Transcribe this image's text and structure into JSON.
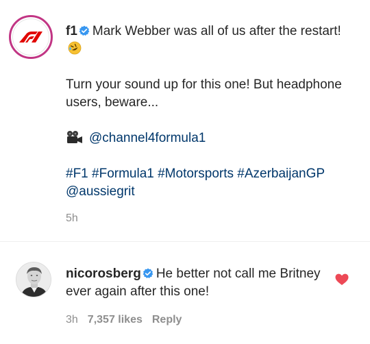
{
  "post": {
    "username": "f1",
    "text_line1": "Mark Webber was all of us after the restart!",
    "text_para2": "Turn your sound up for this one! But headphone users, beware...",
    "mention_channel": "@channel4formula1",
    "hashtags": "#F1 #Formula1 #Motorsports #AzerbaijanGP",
    "mention_user": "@aussiegrit",
    "time": "5h",
    "icons": {
      "avatar": "f1-logo-icon",
      "verified": "verified-badge-icon",
      "emoji": "rolling-laughing-emoji-icon",
      "camera": "movie-camera-icon"
    }
  },
  "comment": {
    "username": "nicorosberg",
    "text": "He better not call me Britney ever again after this one!",
    "time": "3h",
    "likes": "7,357 likes",
    "reply_label": "Reply",
    "icons": {
      "avatar": "profile-photo",
      "verified": "verified-badge-icon",
      "like": "heart-icon"
    }
  },
  "colors": {
    "link": "#00376b",
    "verified": "#3897f0",
    "heart": "#ed4956",
    "f1_red": "#e10600",
    "story_ring": "#c13584",
    "muted": "#8e8e8e"
  }
}
